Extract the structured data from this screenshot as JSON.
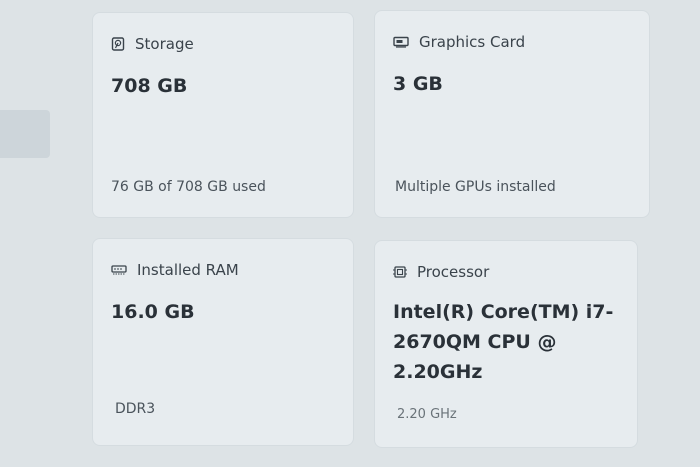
{
  "cards": {
    "storage": {
      "icon": "storage-drive-icon",
      "label": "Storage",
      "value": "708 GB",
      "detail": "76 GB of 708 GB used"
    },
    "graphics": {
      "icon": "graphics-card-icon",
      "label": "Graphics Card",
      "value": "3 GB",
      "detail": "Multiple GPUs installed"
    },
    "ram": {
      "icon": "memory-ram-icon",
      "label": "Installed RAM",
      "value": "16.0 GB",
      "detail": "DDR3"
    },
    "processor": {
      "icon": "processor-chip-icon",
      "label": "Processor",
      "value": "Intel(R) Core(TM) i7-2670QM CPU @ 2.20GHz",
      "detail": "2.20 GHz"
    }
  }
}
